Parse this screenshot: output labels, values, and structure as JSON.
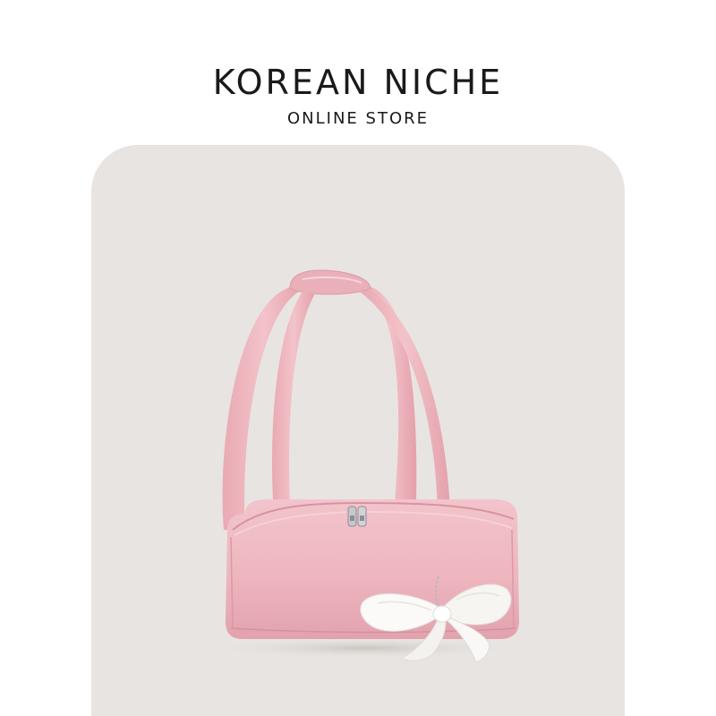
{
  "brand": {
    "name": "KOREAN NICHE",
    "tagline": "ONLINE STORE"
  },
  "product_image": {
    "subject": "pink-shoulder-bag-with-white-ribbon-bow",
    "colors": {
      "background": "#e8e4e1",
      "bag": "#eeb6bf",
      "bag_shadow": "#d9929e",
      "ribbon": "#fbfaf8",
      "hardware": "#b8b8bc"
    }
  }
}
